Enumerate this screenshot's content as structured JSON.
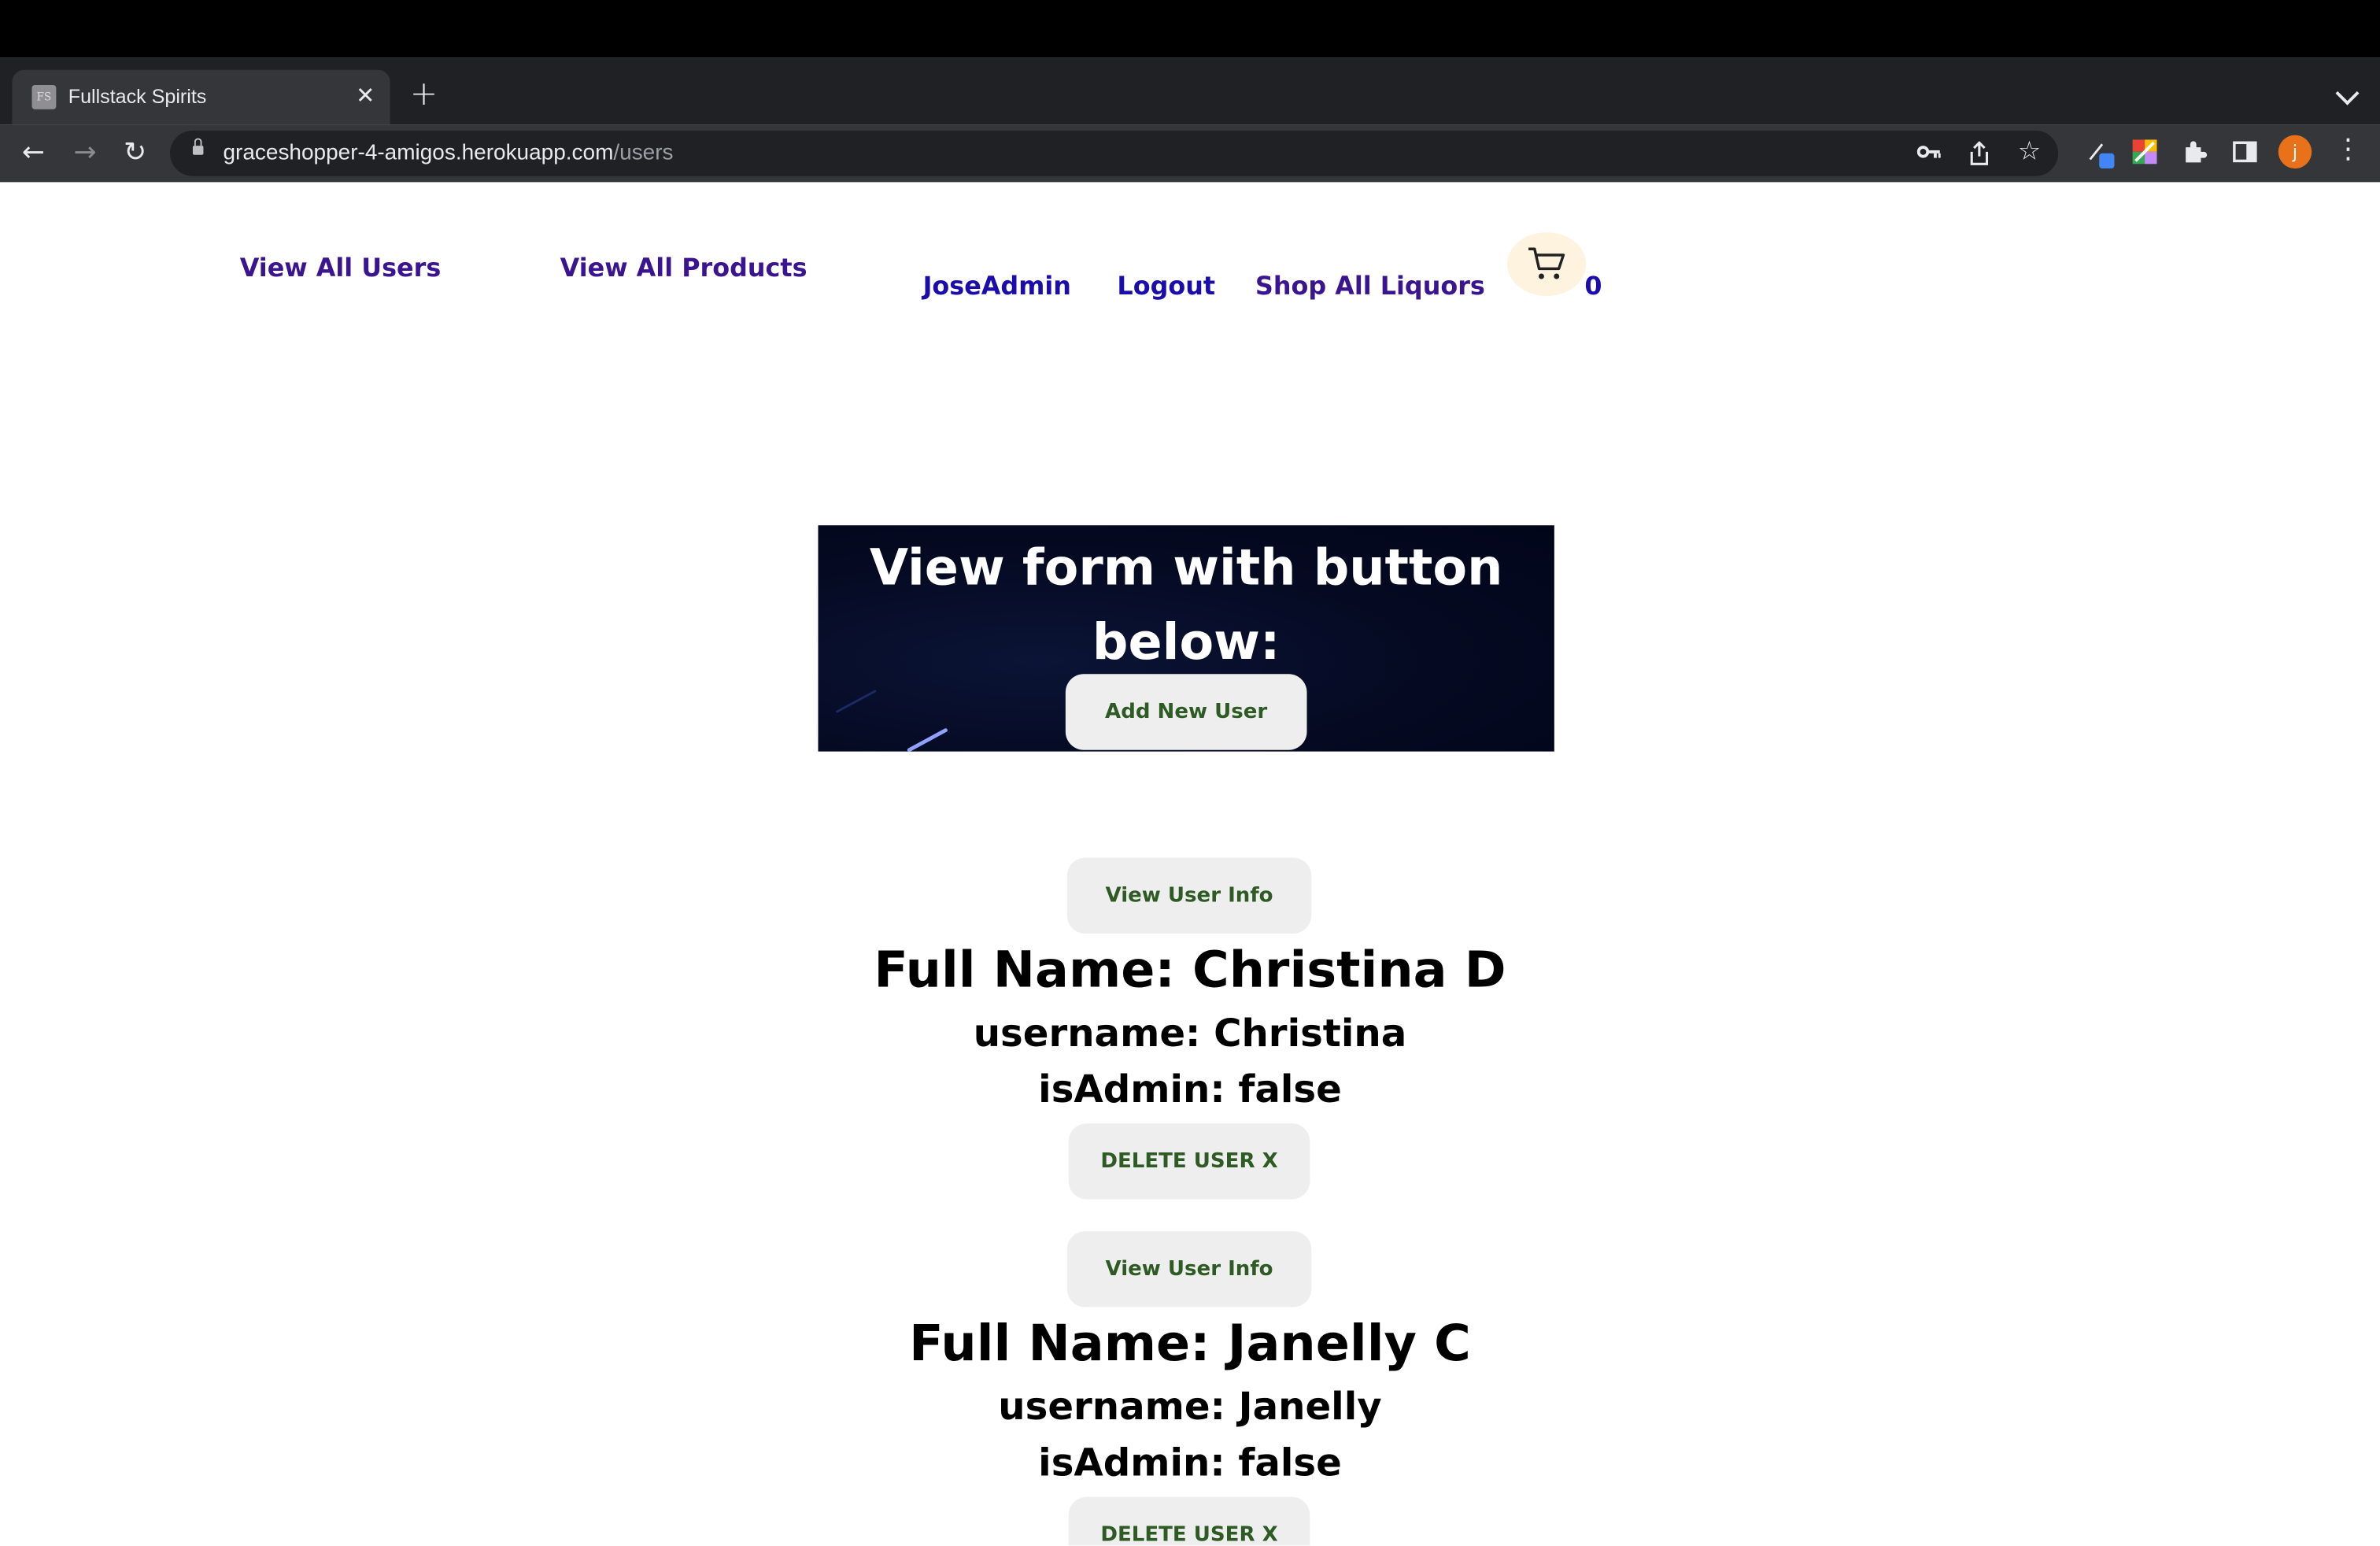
{
  "browser": {
    "tab_title": "Fullstack Spirits",
    "tab_favicon": "FS",
    "url_host": "graceshopper-4-amigos.herokuapp.com",
    "url_path": "/users",
    "profile_initial": "j"
  },
  "nav": {
    "view_all_users": "View All Users",
    "view_all_products": "View All Products",
    "username": "JoseAdmin",
    "logout": "Logout",
    "shop_all": "Shop All Liquors",
    "cart_count": "0"
  },
  "hero": {
    "title": "View form with button below:",
    "add_button": "Add New User"
  },
  "users": [
    {
      "view_button": "View User Info",
      "full_name": "Full Name: Christina D",
      "username": "username: Christina",
      "is_admin": "isAdmin: false",
      "delete_button": "DELETE USER X"
    },
    {
      "view_button": "View User Info",
      "full_name": "Full Name: Janelly C",
      "username": "username: Janelly",
      "is_admin": "isAdmin: false",
      "delete_button": "DELETE USER X"
    }
  ],
  "colors": {
    "nav_purple": "#3b1590",
    "nav_blue": "#1a0dab",
    "button_text": "#2e5a24",
    "button_bg": "#eeeeee",
    "hero_bg": "#050a22"
  }
}
